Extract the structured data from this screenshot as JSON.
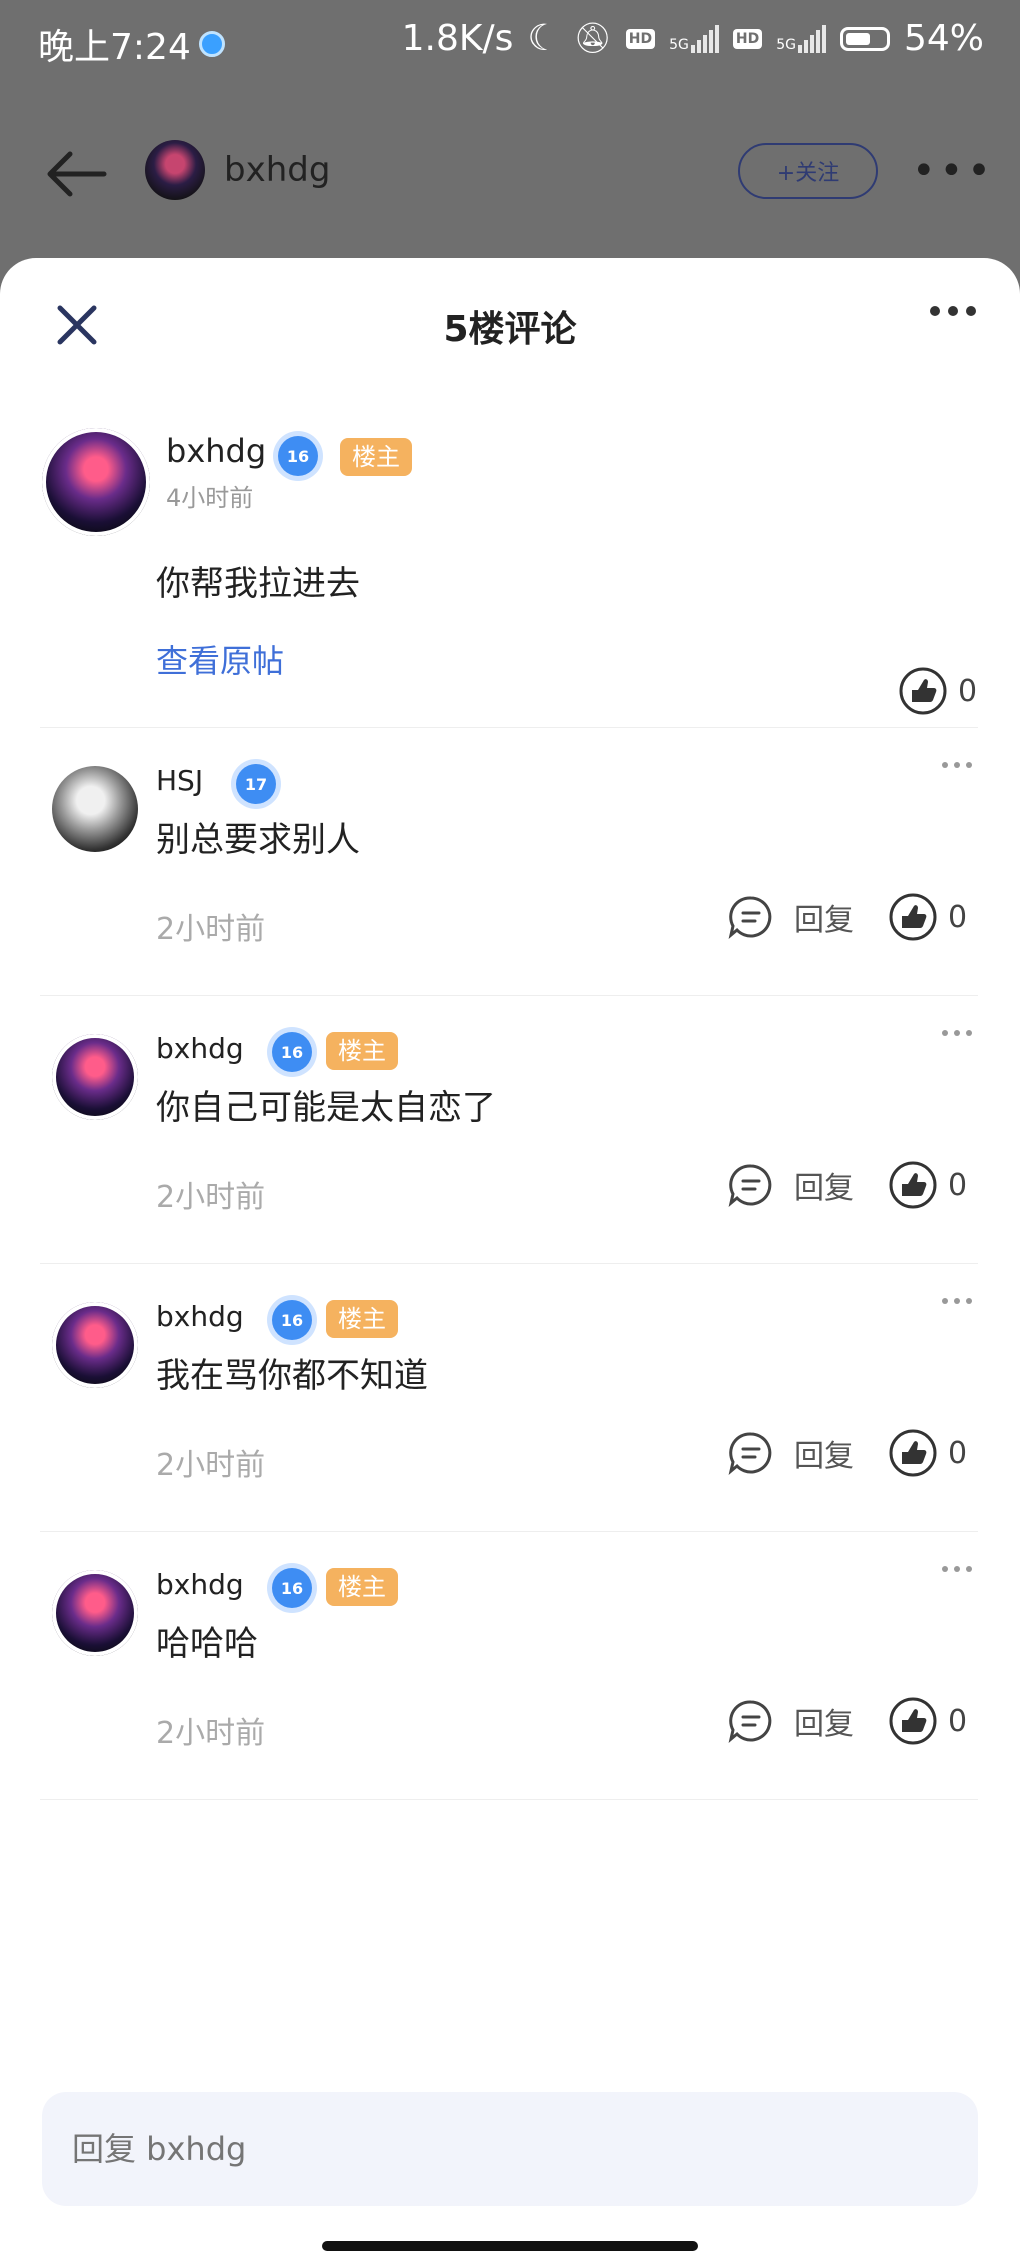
{
  "status_bar": {
    "time": "晚上7:24",
    "speed": "1.8K/s",
    "hd1": "HD",
    "net1": "5G",
    "hd2": "HD",
    "net2": "5G",
    "battery": "54%"
  },
  "header": {
    "username": "bxhdg",
    "follow_label": "+关注",
    "more_label": "•••"
  },
  "sheet": {
    "title": "5楼评论"
  },
  "main_post": {
    "author": "bxhdg",
    "level": "16",
    "owner_badge": "楼主",
    "time": "4小时前",
    "text": "你帮我拉进去",
    "view_original": "查看原帖",
    "likes": "0"
  },
  "replies": [
    {
      "author": "HSJ",
      "level": "17",
      "owner_badge": "",
      "text": "别总要求别人",
      "time": "2小时前",
      "reply_label": "回复",
      "likes": "0",
      "avatar": "gray"
    },
    {
      "author": "bxhdg",
      "level": "16",
      "owner_badge": "楼主",
      "text": "你自己可能是太自恋了",
      "time": "2小时前",
      "reply_label": "回复",
      "likes": "0",
      "avatar": "purple"
    },
    {
      "author": "bxhdg",
      "level": "16",
      "owner_badge": "楼主",
      "text": "我在骂你都不知道",
      "time": "2小时前",
      "reply_label": "回复",
      "likes": "0",
      "avatar": "purple"
    },
    {
      "author": "bxhdg",
      "level": "16",
      "owner_badge": "楼主",
      "text": "哈哈哈",
      "time": "2小时前",
      "reply_label": "回复",
      "likes": "0",
      "avatar": "purple"
    }
  ],
  "input": {
    "placeholder": "回复 bxhdg"
  },
  "colors": {
    "accent_link": "#3f6fd8",
    "owner_badge": "#f5b25f",
    "level_badge": "#3e8df3",
    "follow_border": "#2f3b73"
  }
}
